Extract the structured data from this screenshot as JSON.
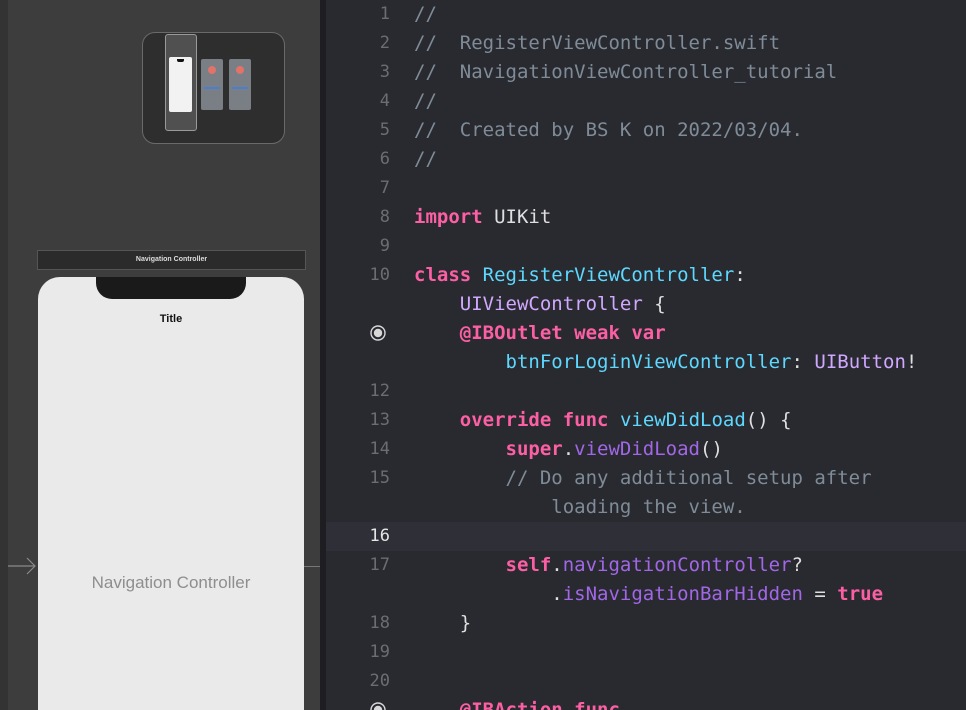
{
  "canvas": {
    "scene_title": "Navigation Controller",
    "nav_bar_title": "Title",
    "scene_label": "Navigation Controller",
    "icons": {
      "entry_arrow": "arrow-right-icon",
      "outlet": "outlet-connection-icon"
    }
  },
  "editor": {
    "current_line": "16",
    "colors": {
      "keyword": "#fc5fa3",
      "type": "#5dd8ff",
      "comment": "#7f8c98",
      "function": "#a167e6",
      "background": "#292a30"
    },
    "lines": [
      {
        "num": "1",
        "tokens": [
          {
            "t": "//",
            "c": "cm"
          }
        ]
      },
      {
        "num": "2",
        "tokens": [
          {
            "t": "//  RegisterViewController.swift",
            "c": "cm"
          }
        ]
      },
      {
        "num": "3",
        "tokens": [
          {
            "t": "//  NavigationViewController_tutorial",
            "c": "cm"
          }
        ]
      },
      {
        "num": "4",
        "tokens": [
          {
            "t": "//",
            "c": "cm"
          }
        ]
      },
      {
        "num": "5",
        "tokens": [
          {
            "t": "//  Created by BS K on 2022/03/04.",
            "c": "cm"
          }
        ]
      },
      {
        "num": "6",
        "tokens": [
          {
            "t": "//",
            "c": "cm"
          }
        ]
      },
      {
        "num": "7",
        "tokens": []
      },
      {
        "num": "8",
        "tokens": [
          {
            "t": "import",
            "c": "kw"
          },
          {
            "t": " UIKit",
            "c": "pl"
          }
        ]
      },
      {
        "num": "9",
        "tokens": []
      },
      {
        "num": "10",
        "tokens": [
          {
            "t": "class",
            "c": "kw"
          },
          {
            "t": " ",
            "c": "pl"
          },
          {
            "t": "RegisterViewController",
            "c": "ty"
          },
          {
            "t": ":",
            "c": "pl"
          }
        ]
      },
      {
        "num": "",
        "tokens": [
          {
            "t": "    ",
            "c": "pl"
          },
          {
            "t": "UIViewController",
            "c": "ty2"
          },
          {
            "t": " {",
            "c": "pl"
          }
        ]
      },
      {
        "num": "",
        "icon": "outlet-connection-icon",
        "tokens": [
          {
            "t": "    ",
            "c": "pl"
          },
          {
            "t": "@IBOutlet weak var",
            "c": "kw"
          }
        ]
      },
      {
        "num": "",
        "tokens": [
          {
            "t": "        ",
            "c": "pl"
          },
          {
            "t": "btnForLoginViewController",
            "c": "ty"
          },
          {
            "t": ": ",
            "c": "pl"
          },
          {
            "t": "UIButton",
            "c": "ty2"
          },
          {
            "t": "!",
            "c": "pl"
          }
        ]
      },
      {
        "num": "12",
        "tokens": []
      },
      {
        "num": "13",
        "tokens": [
          {
            "t": "    ",
            "c": "pl"
          },
          {
            "t": "override func",
            "c": "kw"
          },
          {
            "t": " ",
            "c": "pl"
          },
          {
            "t": "viewDidLoad",
            "c": "ty"
          },
          {
            "t": "() {",
            "c": "pl"
          }
        ]
      },
      {
        "num": "14",
        "tokens": [
          {
            "t": "        ",
            "c": "pl"
          },
          {
            "t": "super",
            "c": "kw"
          },
          {
            "t": ".",
            "c": "pl"
          },
          {
            "t": "viewDidLoad",
            "c": "fn"
          },
          {
            "t": "()",
            "c": "pl"
          }
        ]
      },
      {
        "num": "15",
        "tokens": [
          {
            "t": "        // Do any additional setup after",
            "c": "cm"
          }
        ]
      },
      {
        "num": "",
        "tokens": [
          {
            "t": "            loading the view.",
            "c": "cm"
          }
        ]
      },
      {
        "num": "16",
        "tokens": []
      },
      {
        "num": "17",
        "tokens": [
          {
            "t": "        ",
            "c": "pl"
          },
          {
            "t": "self",
            "c": "kw"
          },
          {
            "t": ".",
            "c": "pl"
          },
          {
            "t": "navigationController",
            "c": "fn"
          },
          {
            "t": "?",
            "c": "pl"
          }
        ]
      },
      {
        "num": "",
        "tokens": [
          {
            "t": "            .",
            "c": "pl"
          },
          {
            "t": "isNavigationBarHidden",
            "c": "fn"
          },
          {
            "t": " = ",
            "c": "pl"
          },
          {
            "t": "true",
            "c": "kw"
          }
        ]
      },
      {
        "num": "18",
        "tokens": [
          {
            "t": "    }",
            "c": "pl"
          }
        ]
      },
      {
        "num": "19",
        "tokens": []
      },
      {
        "num": "20",
        "tokens": []
      },
      {
        "num": "",
        "icon": "outlet-connection-icon",
        "tokens": [
          {
            "t": "    ",
            "c": "pl"
          },
          {
            "t": "@IBAction func",
            "c": "kw"
          }
        ]
      }
    ]
  }
}
